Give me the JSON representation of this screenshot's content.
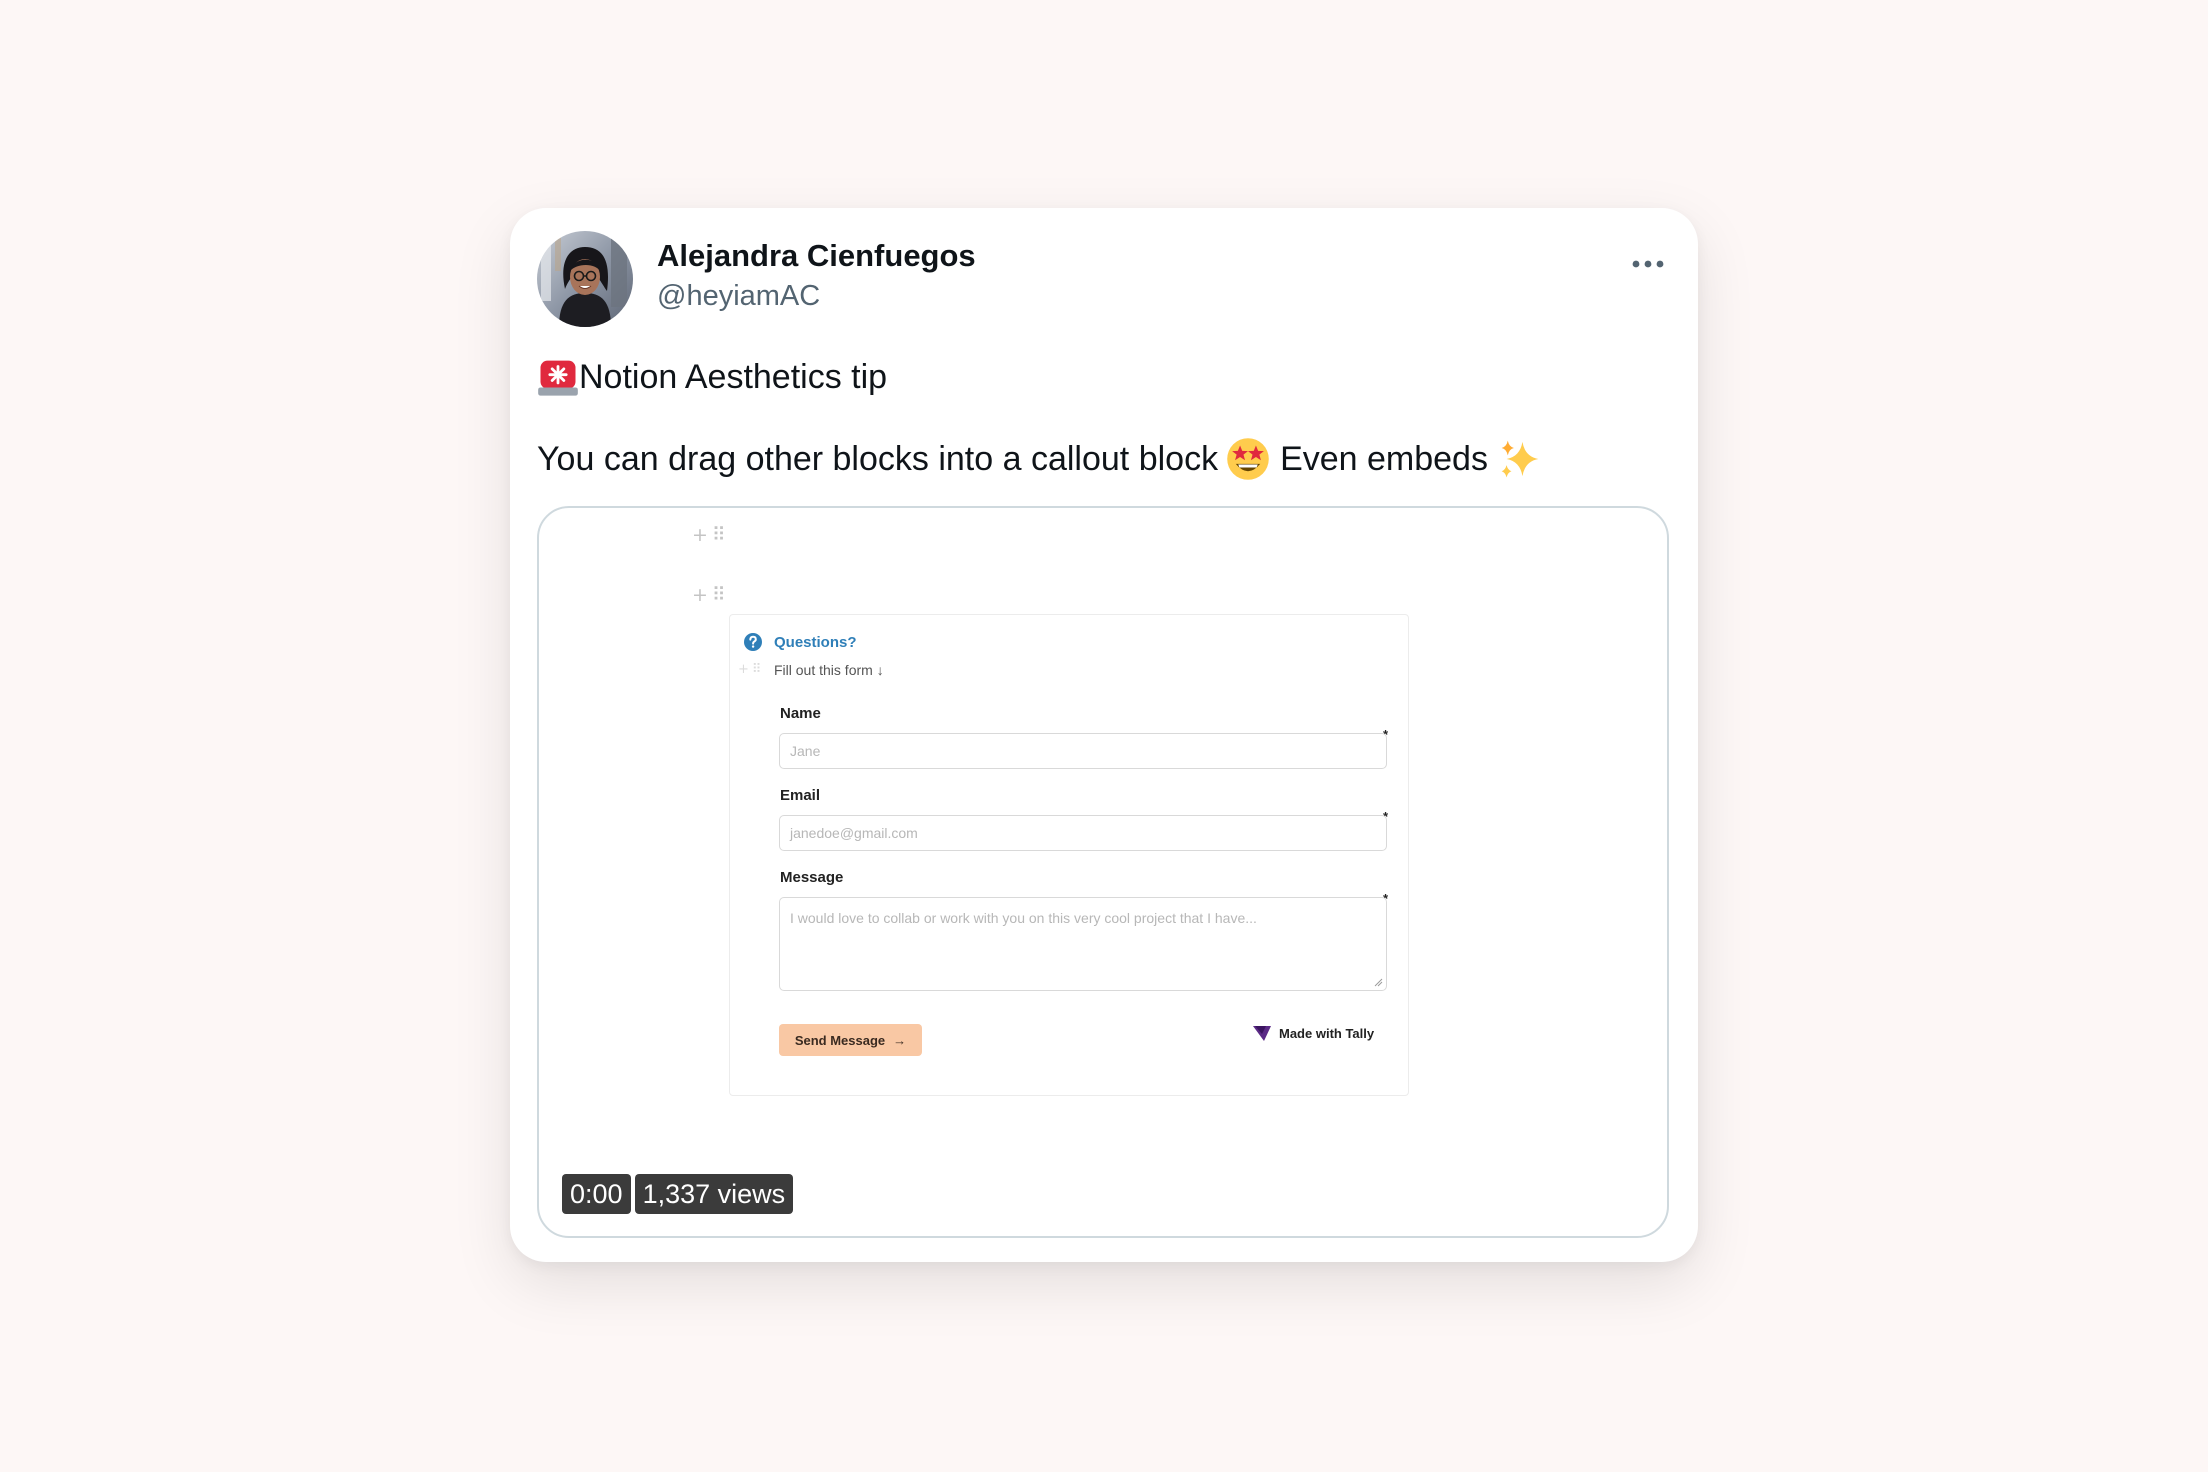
{
  "tweet": {
    "author": {
      "display_name": "Alejandra Cienfuegos",
      "handle": "@heyiamAC"
    },
    "line1": {
      "emoji_icon": "rotating-light-icon",
      "text": "Notion Aesthetics tip"
    },
    "line2": {
      "text_before": "You can drag other blocks into a callout block",
      "emoji_1_icon": "star-struck-icon",
      "text_after": "Even embeds",
      "emoji_2_icon": "sparkles-icon"
    },
    "more_icon": "ellipsis-icon"
  },
  "media": {
    "callout": {
      "title": "Questions?",
      "subtitle": "Fill out this form ↓",
      "icon": "question-circle-icon"
    },
    "form": {
      "name_label": "Name",
      "name_placeholder": "Jane",
      "email_label": "Email",
      "email_placeholder": "janedoe@gmail.com",
      "message_label": "Message",
      "message_placeholder": "I would love to collab or work with you on this very cool project that I have...",
      "required_mark": "*",
      "submit_label": "Send Message",
      "submit_arrow": "→",
      "branding": "Made with Tally"
    },
    "video": {
      "timestamp": "0:00",
      "views": "1,337 views"
    }
  },
  "colors": {
    "background": "#fdf7f6",
    "card": "#ffffff",
    "callout_title": "#2f7fb8",
    "submit_button": "#f9c8a4",
    "tally_logo": "#5b2a86",
    "badge": "#3b3b3b"
  }
}
